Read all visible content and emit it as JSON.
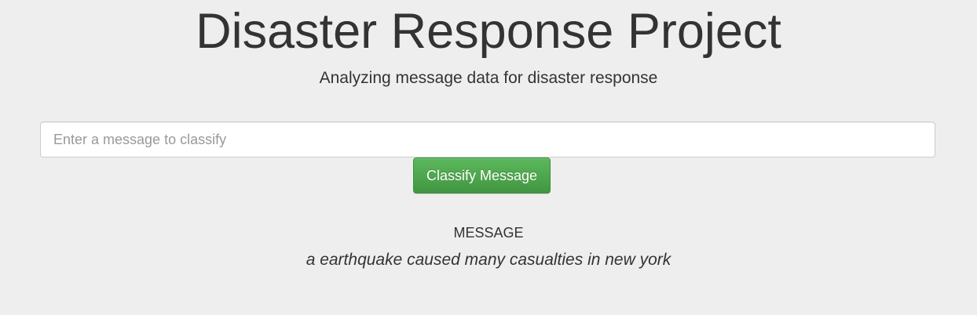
{
  "header": {
    "title": "Disaster Response Project",
    "subtitle": "Analyzing message data for disaster response"
  },
  "form": {
    "input_value": "",
    "input_placeholder": "Enter a message to classify",
    "submit_label": "Classify Message"
  },
  "result": {
    "heading": "MESSAGE",
    "message": "a earthquake caused many casualties in new york"
  },
  "colors": {
    "background": "#eeeeee",
    "text": "#333333",
    "button_green": "#5cb85c",
    "button_green_dark": "#419641",
    "input_border": "#cccccc"
  }
}
